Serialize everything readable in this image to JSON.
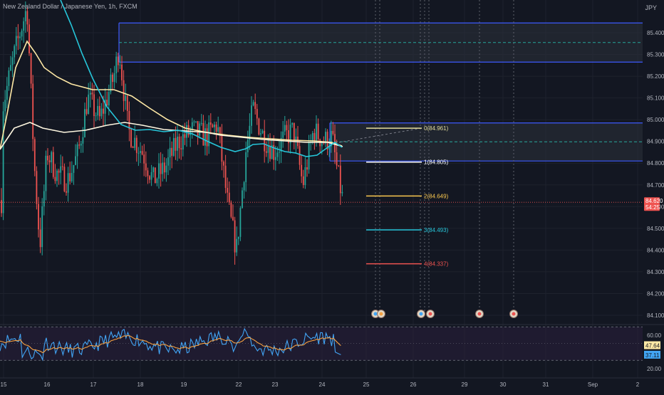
{
  "header": {
    "symbol_title": "New Zealand Dollar / Japanese Yen, 1h, FXCM",
    "currency": "JPY"
  },
  "colors": {
    "background": "#131722",
    "grid": "#1e222d",
    "up": "#26a69a",
    "down": "#ef5350",
    "ma_slow": "#ffe9a6",
    "ma_fast": "#26c6da",
    "zone_border": "#3d5afe",
    "zone_fill": "#2a2e39",
    "rsi_line": "#42a5f5",
    "rsi_signal": "#f5a142",
    "rsi_band": "#2a1f3d",
    "fib_0": "#e4dd9c",
    "fib_1": "#ffffff",
    "fib_2": "#f9c74f",
    "fib_3": "#26c6da",
    "fib_4": "#ef5350",
    "current_price": "#ef5350"
  },
  "chart_data": {
    "type": "candlestick",
    "price_axis": {
      "ticks": [
        "85.400",
        "85.300",
        "85.200",
        "85.100",
        "85.000",
        "84.900",
        "84.800",
        "84.700",
        "84.600",
        "84.500",
        "84.400",
        "84.300",
        "84.200",
        "84.100"
      ],
      "ylim": [
        84.06,
        85.46
      ]
    },
    "time_axis": {
      "ticks": [
        "15",
        "16",
        "17",
        "18",
        "19",
        "22",
        "23",
        "24",
        "25",
        "26",
        "29",
        "30",
        "31",
        "Sep",
        "2"
      ]
    },
    "current_price": {
      "value": "84.620",
      "countdown": "54:25"
    },
    "zones": [
      {
        "top": 85.445,
        "bottom": 85.265,
        "mid": 85.355
      },
      {
        "top": 84.985,
        "bottom": 84.81,
        "mid": 84.898
      }
    ],
    "fib_levels": [
      {
        "label": "0(84.961)",
        "value": 84.961
      },
      {
        "label": "1(84.805)",
        "value": 84.805
      },
      {
        "label": "2(84.649)",
        "value": 84.649
      },
      {
        "label": "3(84.493)",
        "value": 84.493
      },
      {
        "label": "4(84.337)",
        "value": 84.337
      }
    ],
    "rsi": {
      "ticks": [
        "60.00",
        "20.00"
      ],
      "band": [
        30,
        70
      ],
      "ylim": [
        15,
        73
      ],
      "rsi_value": "37.11",
      "signal_value": "47.64"
    }
  }
}
